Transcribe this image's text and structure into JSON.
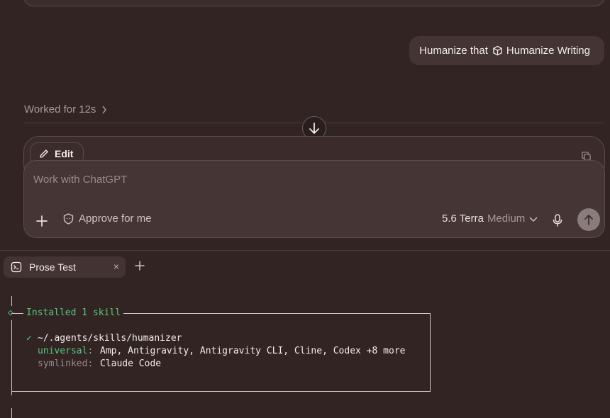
{
  "chat": {
    "user_message": "Humanize that",
    "skill_name": "Humanize Writing",
    "worked_label": "Worked for 12s"
  },
  "edit_card": {
    "edit_label": "Edit"
  },
  "composer": {
    "placeholder": "Work with ChatGPT",
    "approve_label": "Approve for me",
    "model_name": "5.6 Terra",
    "effort": "Medium"
  },
  "terminal": {
    "tab_label": "Prose Test",
    "close_glyph": "×",
    "header_symbol": "◇",
    "header_text": "Installed 1 skill",
    "check_glyph": "✓",
    "skill_path": "~/.agents/skills/humanizer",
    "universal_key": "universal:",
    "universal_value": "Amp, Antigravity, Antigravity CLI, Cline, Codex +8 more",
    "symlinked_key": "symlinked:",
    "symlinked_value": "Claude Code"
  },
  "icons": [
    "chevron-right-icon",
    "arrow-down-icon",
    "pencil-icon",
    "copy-icon",
    "plus-icon",
    "shield-icon",
    "chevron-down-icon",
    "mic-icon",
    "arrow-up-icon",
    "terminal-icon",
    "skill-cube-icon"
  ],
  "colors": {
    "background": "#332424",
    "success": "#55c77d"
  }
}
